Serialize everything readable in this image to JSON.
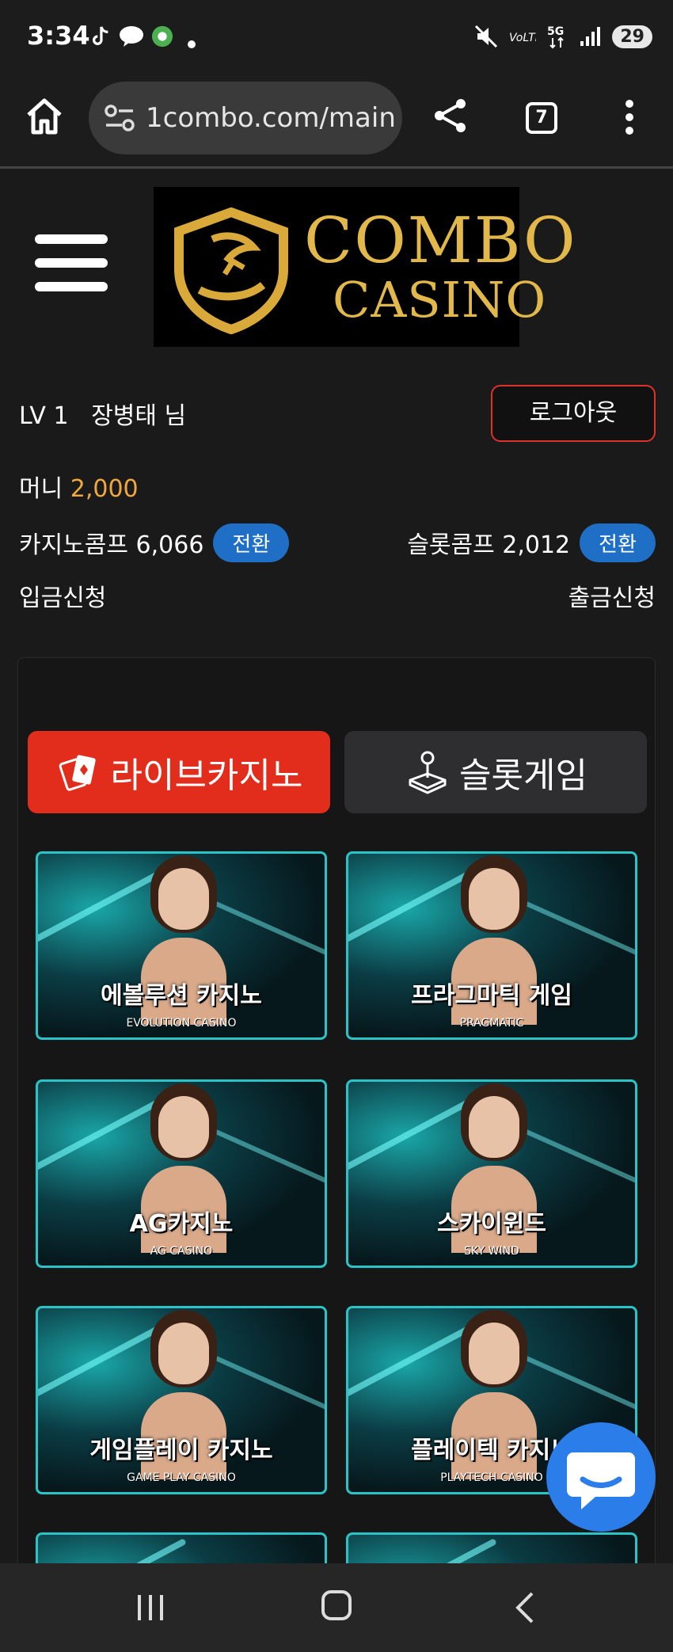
{
  "status": {
    "time": "3:34",
    "battery": "29"
  },
  "browser": {
    "url": "1combo.com/main",
    "tab_count": "7"
  },
  "logo": {
    "line1": "COMBO",
    "line2": "CASINO"
  },
  "user": {
    "level": "LV 1",
    "name": "장병태 님",
    "logout_label": "로그아웃",
    "money_label": "머니",
    "money_value": "2,000",
    "casino_comp_label": "카지노콤프 6,066",
    "slot_comp_label": "슬롯콤프 2,012",
    "convert_label": "전환",
    "deposit_label": "입금신청",
    "withdraw_label": "출금신청"
  },
  "tabs": [
    {
      "label": "라이브카지노",
      "icon": "cards-icon",
      "active": true
    },
    {
      "label": "슬롯게임",
      "icon": "joystick-icon",
      "active": false
    }
  ],
  "games": [
    {
      "title": "에볼루션 카지노",
      "subtitle": "EVOLUTION CASINO"
    },
    {
      "title": "프라그마틱 게임",
      "subtitle": "PRAGMATIC"
    },
    {
      "title": "AG카지노",
      "subtitle": "AG CASINO"
    },
    {
      "title": "스카이윈드",
      "subtitle": "SKY WIND"
    },
    {
      "title": "게임플레이 카지노",
      "subtitle": "GAME PLAY CASINO"
    },
    {
      "title": "플레이텍 카지노",
      "subtitle": "PLAYTECH CASINO"
    }
  ],
  "colors": {
    "accent_red": "#e22c1c",
    "money_orange": "#f2a93b",
    "pill_blue": "#1f6fc6",
    "card_border": "#29c3c8",
    "logo_gold": "#e2b84a"
  }
}
